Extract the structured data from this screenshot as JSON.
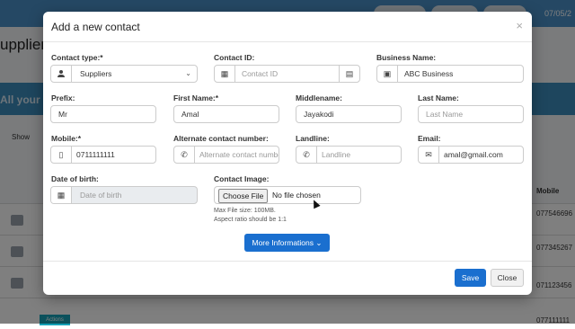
{
  "background": {
    "page_title": "uppliers",
    "band_text": "All your S",
    "date": "07/05/2",
    "show_label": "Show",
    "mobile_header": "Mobile",
    "rows": [
      {
        "mobile": "077546696"
      },
      {
        "mobile": "077345267"
      },
      {
        "mobile": "071123456"
      },
      {
        "mobile": "077111111"
      }
    ],
    "badge": "Actions"
  },
  "modal": {
    "title": "Add a new contact",
    "close_icon": "×",
    "contact_type": {
      "label": "Contact type:*",
      "value": "Suppliers",
      "icon": "user-icon"
    },
    "contact_id": {
      "label": "Contact ID:",
      "placeholder": "Contact ID",
      "icon": "id-badge-icon"
    },
    "business_name": {
      "label": "Business Name:",
      "value": "ABC Business",
      "icon": "briefcase-icon"
    },
    "prefix": {
      "label": "Prefix:",
      "value": "Mr"
    },
    "first_name": {
      "label": "First Name:*",
      "value": "Amal"
    },
    "middle_name": {
      "label": "Middlename:",
      "value": "Jayakodi"
    },
    "last_name": {
      "label": "Last Name:",
      "placeholder": "Last Name"
    },
    "mobile": {
      "label": "Mobile:*",
      "value": "0711111111",
      "icon": "mobile-icon"
    },
    "alt_contact": {
      "label": "Alternate contact number:",
      "placeholder": "Alternate contact number",
      "icon": "phone-icon"
    },
    "landline": {
      "label": "Landline:",
      "placeholder": "Landline",
      "icon": "phone-icon"
    },
    "email": {
      "label": "Email:",
      "value": "amal@gmail.com",
      "icon": "envelope-icon"
    },
    "dob": {
      "label": "Date of birth:",
      "placeholder": "Date of birth",
      "icon": "calendar-icon"
    },
    "contact_image": {
      "label": "Contact Image:",
      "button": "Choose File",
      "status": "No file chosen",
      "help_size": "Max File size: 100MB.",
      "help_ratio": "Aspect ratio should be 1:1"
    },
    "more_button": "More Informations",
    "save_button": "Save",
    "close_button": "Close"
  },
  "colors": {
    "primary": "#1a6fcf",
    "header": "#4a90c8",
    "overlay": "rgba(0,0,0,0.5)"
  }
}
